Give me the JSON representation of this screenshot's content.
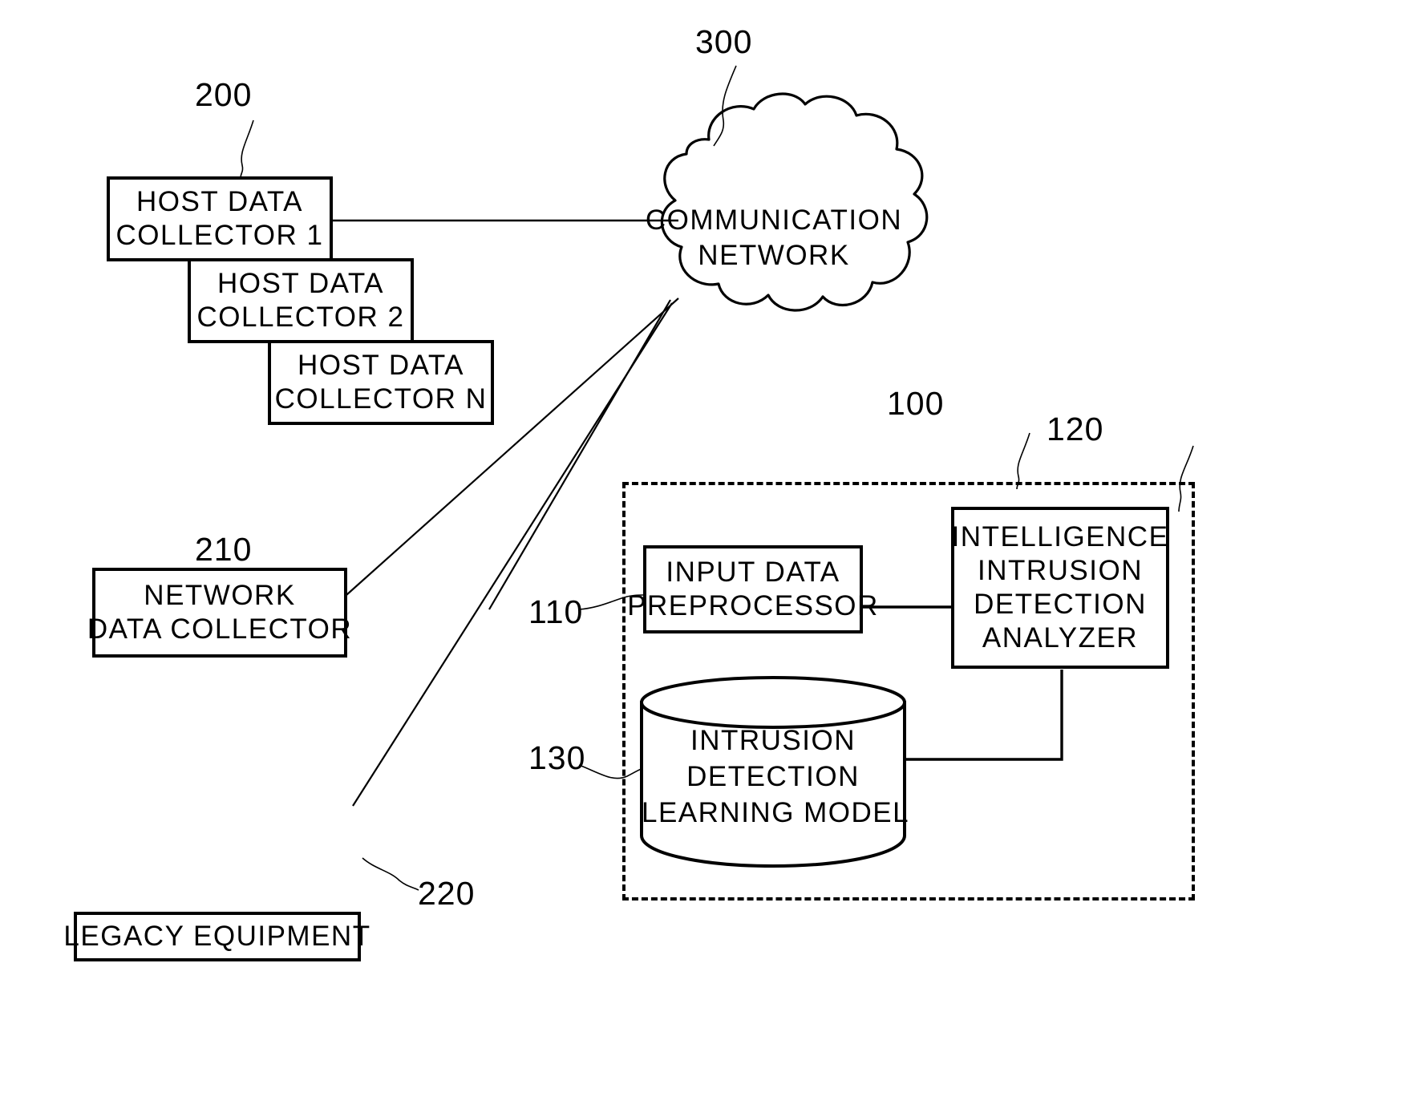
{
  "figure": {
    "type": "patent-block-diagram",
    "background": "#ffffff",
    "line_color": "#000000"
  },
  "collectors": {
    "ref": "200",
    "host_1": {
      "line1": "HOST DATA",
      "line2": "COLLECTOR 1"
    },
    "host_2": {
      "line1": "HOST DATA",
      "line2": "COLLECTOR 2"
    },
    "host_n": {
      "line1": "HOST DATA",
      "line2": "COLLECTOR N"
    }
  },
  "network_collector": {
    "ref": "210",
    "line1": "NETWORK",
    "line2": "DATA COLLECTOR"
  },
  "legacy_equipment": {
    "ref": "220",
    "label": "LEGACY EQUIPMENT"
  },
  "cloud": {
    "ref": "300",
    "line1": "COMMUNICATION",
    "line2": "NETWORK"
  },
  "system": {
    "ref": "100",
    "preprocessor": {
      "ref": "110",
      "line1": "INPUT DATA",
      "line2": "PREPROCESSOR"
    },
    "analyzer": {
      "ref": "120",
      "line1": "INTELLIGENCE",
      "line2": "INTRUSION",
      "line3": "DETECTION",
      "line4": "ANALYZER"
    },
    "learning_model": {
      "ref": "130",
      "line1": "INTRUSION",
      "line2": "DETECTION",
      "line3": "LEARNING MODEL"
    }
  }
}
